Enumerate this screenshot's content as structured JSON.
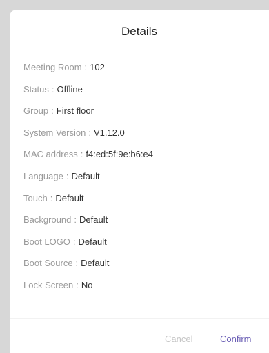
{
  "dialog": {
    "title": "Details",
    "separator": ":",
    "rows": [
      {
        "label": "Meeting Room",
        "value": "102"
      },
      {
        "label": "Status",
        "value": "Offline"
      },
      {
        "label": "Group",
        "value": "First floor"
      },
      {
        "label": "System Version",
        "value": "V1.12.0"
      },
      {
        "label": "MAC address",
        "value": "f4:ed:5f:9e:b6:e4"
      },
      {
        "label": "Language",
        "value": "Default"
      },
      {
        "label": "Touch",
        "value": "Default"
      },
      {
        "label": "Background",
        "value": "Default"
      },
      {
        "label": "Boot LOGO",
        "value": "Default"
      },
      {
        "label": "Boot Source",
        "value": "Default"
      },
      {
        "label": "Lock Screen",
        "value": "No"
      }
    ],
    "cancel_label": "Cancel",
    "confirm_label": "Confirm"
  },
  "colors": {
    "accent": "#6b5fb5",
    "disabled": "#c6c6c6",
    "label": "#9a9a9a"
  }
}
